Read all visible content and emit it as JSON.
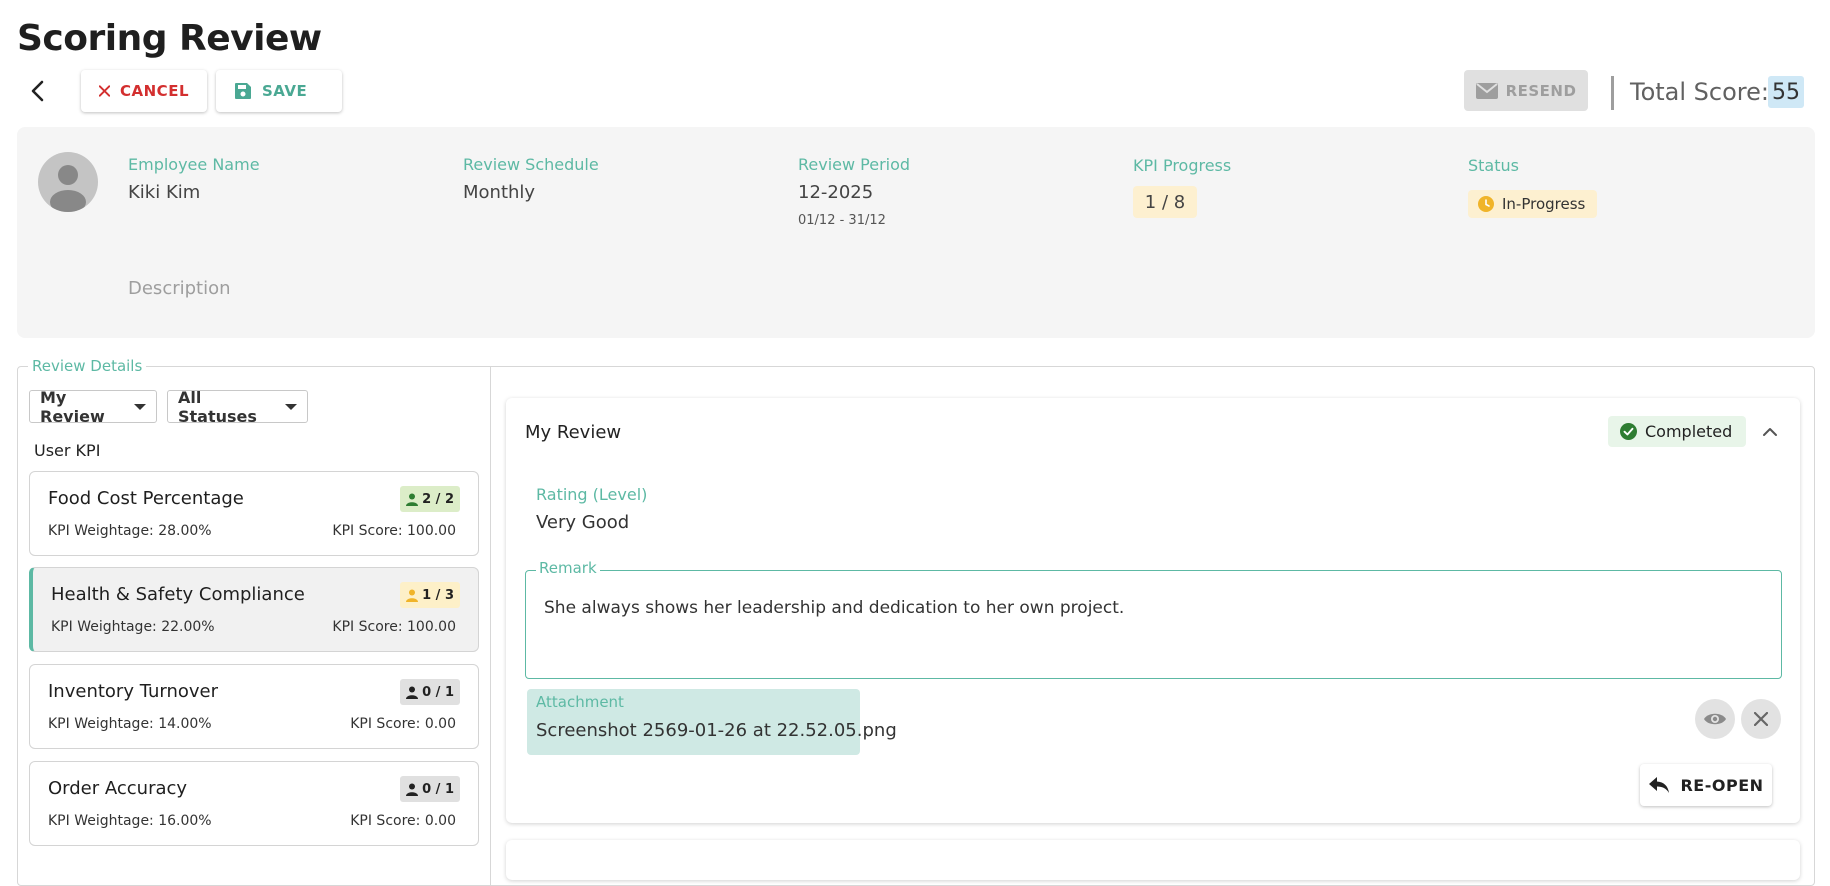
{
  "header": {
    "title": "Scoring Review",
    "cancel_label": "CANCEL",
    "save_label": "SAVE",
    "resend_label": "RESEND",
    "total_score_label": "Total Score:",
    "total_score_value": "55"
  },
  "info": {
    "employee_name_label": "Employee Name",
    "employee_name": "Kiki Kim",
    "review_schedule_label": "Review Schedule",
    "review_schedule": "Monthly",
    "review_period_label": "Review Period",
    "review_period": "12-2025",
    "review_period_range": "01/12 - 31/12",
    "kpi_progress_label": "KPI Progress",
    "kpi_progress": "1 / 8",
    "status_label": "Status",
    "status": "In-Progress",
    "description_label": "Description"
  },
  "review_details": {
    "legend": "Review Details",
    "filter_review": "My Review",
    "filter_status": "All Statuses",
    "group_label": "User KPI",
    "kpis": [
      {
        "title": "Food Cost Percentage",
        "weightage": "KPI Weightage: 28.00%",
        "score": "KPI Score: 100.00",
        "badge": "2 / 2",
        "badge_color": "#dcedc8",
        "icon_color": "#2e7d32"
      },
      {
        "title": "Health & Safety Compliance",
        "weightage": "KPI Weightage: 22.00%",
        "score": "KPI Score: 100.00",
        "badge": "1 / 3",
        "badge_color": "#fdf0c8",
        "icon_color": "#f0b429"
      },
      {
        "title": "Inventory Turnover",
        "weightage": "KPI Weightage: 14.00%",
        "score": "KPI Score: 0.00",
        "badge": "0 / 1",
        "badge_color": "#e0e0e0",
        "icon_color": "#222222"
      },
      {
        "title": "Order Accuracy",
        "weightage": "KPI Weightage: 16.00%",
        "score": "KPI Score: 0.00",
        "badge": "0 / 1",
        "badge_color": "#e0e0e0",
        "icon_color": "#222222"
      }
    ]
  },
  "review": {
    "title": "My Review",
    "status": "Completed",
    "rating_label": "Rating (Level)",
    "rating_value": "Very Good",
    "remark_label": "Remark",
    "remark_text": "She always shows her leadership and dedication to her own project.",
    "attachment_label": "Attachment",
    "attachment_name": "Screenshot 2569-01-26 at 22.52.05.png",
    "reopen_label": "RE-OPEN"
  },
  "colors": {
    "accent": "#5db9a4",
    "danger": "#d32f2f",
    "success": "#2e7d32",
    "warning": "#f0b429"
  },
  "icons": [
    "back-arrow-icon",
    "close-icon",
    "save-disk-icon",
    "mail-icon",
    "user-avatar-icon",
    "clock-icon",
    "person-icon",
    "check-circle-icon",
    "chevron-up-icon",
    "eye-icon",
    "reply-icon"
  ]
}
